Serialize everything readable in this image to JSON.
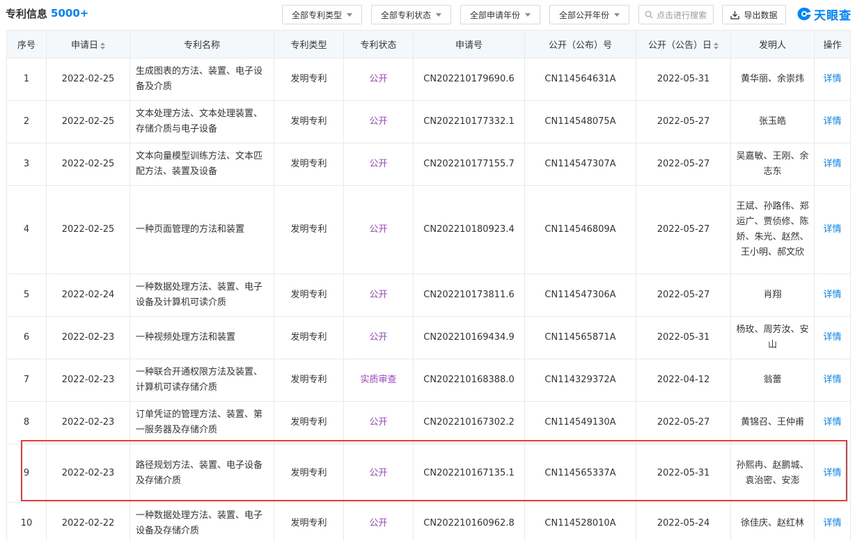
{
  "header": {
    "title": "专利信息",
    "count": "5000+"
  },
  "filters": {
    "type": "全部专利类型",
    "status": "全部专利状态",
    "apply_year": "全部申请年份",
    "publish_year": "全部公开年份"
  },
  "search": {
    "placeholder": "点击进行搜索"
  },
  "export": {
    "label": "导出数据"
  },
  "logo": {
    "text": "天眼查"
  },
  "table": {
    "columns": [
      "序号",
      "申请日",
      "专利名称",
      "专利类型",
      "专利状态",
      "申请号",
      "公开（公布）号",
      "公开（公告）日",
      "发明人",
      "操作"
    ],
    "rows": [
      {
        "no": "1",
        "apply_date": "2022-02-25",
        "name": "生成图表的方法、装置、电子设备及介质",
        "type": "发明专利",
        "status": "公开",
        "app_no": "CN202210179690.6",
        "pub_no": "CN114564631A",
        "pub_date": "2022-05-31",
        "inventors": "黄华丽、余崇炜",
        "op": "详情"
      },
      {
        "no": "2",
        "apply_date": "2022-02-25",
        "name": "文本处理方法、文本处理装置、存储介质与电子设备",
        "type": "发明专利",
        "status": "公开",
        "app_no": "CN202210177332.1",
        "pub_no": "CN114548075A",
        "pub_date": "2022-05-27",
        "inventors": "张玉皓",
        "op": "详情"
      },
      {
        "no": "3",
        "apply_date": "2022-02-25",
        "name": "文本向量模型训练方法、文本匹配方法、装置及设备",
        "type": "发明专利",
        "status": "公开",
        "app_no": "CN202210177155.7",
        "pub_no": "CN114547307A",
        "pub_date": "2022-05-27",
        "inventors": "吴嘉敏、王刚、余志东",
        "op": "详情"
      },
      {
        "no": "4",
        "apply_date": "2022-02-25",
        "name": "一种页面管理的方法和装置",
        "type": "发明专利",
        "status": "公开",
        "app_no": "CN202210180923.4",
        "pub_no": "CN114546809A",
        "pub_date": "2022-05-27",
        "inventors": "王斌、孙路伟、郑运广、贾侦修、陈娇、朱光、赵然、王小明、郝文欣",
        "op": "详情"
      },
      {
        "no": "5",
        "apply_date": "2022-02-24",
        "name": "一种数据处理方法、装置、电子设备及计算机可读介质",
        "type": "发明专利",
        "status": "公开",
        "app_no": "CN202210173811.6",
        "pub_no": "CN114547306A",
        "pub_date": "2022-05-27",
        "inventors": "肖翔",
        "op": "详情"
      },
      {
        "no": "6",
        "apply_date": "2022-02-23",
        "name": "一种视频处理方法和装置",
        "type": "发明专利",
        "status": "公开",
        "app_no": "CN202210169434.9",
        "pub_no": "CN114565871A",
        "pub_date": "2022-05-31",
        "inventors": "杨玫、周芳汝、安山",
        "op": "详情"
      },
      {
        "no": "7",
        "apply_date": "2022-02-23",
        "name": "一种联合开通权限方法及装置、计算机可读存储介质",
        "type": "发明专利",
        "status": "实质审查",
        "app_no": "CN202210168388.0",
        "pub_no": "CN114329372A",
        "pub_date": "2022-04-12",
        "inventors": "翁蕾",
        "op": "详情"
      },
      {
        "no": "8",
        "apply_date": "2022-02-23",
        "name": "订单凭证的管理方法、装置、第一服务器及存储介质",
        "type": "发明专利",
        "status": "公开",
        "app_no": "CN202210167302.2",
        "pub_no": "CN114549130A",
        "pub_date": "2022-05-27",
        "inventors": "黄锦召、王仲甫",
        "op": "详情"
      },
      {
        "no": "9",
        "apply_date": "2022-02-23",
        "name": "路径规划方法、装置、电子设备及存储介质",
        "type": "发明专利",
        "status": "公开",
        "app_no": "CN202210167135.1",
        "pub_no": "CN114565337A",
        "pub_date": "2022-05-31",
        "inventors": "孙熙冉、赵鹏城、袁治密、安澎",
        "op": "详情"
      },
      {
        "no": "10",
        "apply_date": "2022-02-22",
        "name": "一种数据处理方法、装置、电子设备及存储介质",
        "type": "发明专利",
        "status": "公开",
        "app_no": "CN202210160962.8",
        "pub_no": "CN114528010A",
        "pub_date": "2022-05-24",
        "inventors": "徐佳庆、赵红林",
        "op": "详情"
      }
    ]
  },
  "colors": {
    "accent": "#0084ff",
    "status": "#a040c8",
    "highlight": "#e53a3a",
    "header_bg": "#f5f8fb"
  }
}
